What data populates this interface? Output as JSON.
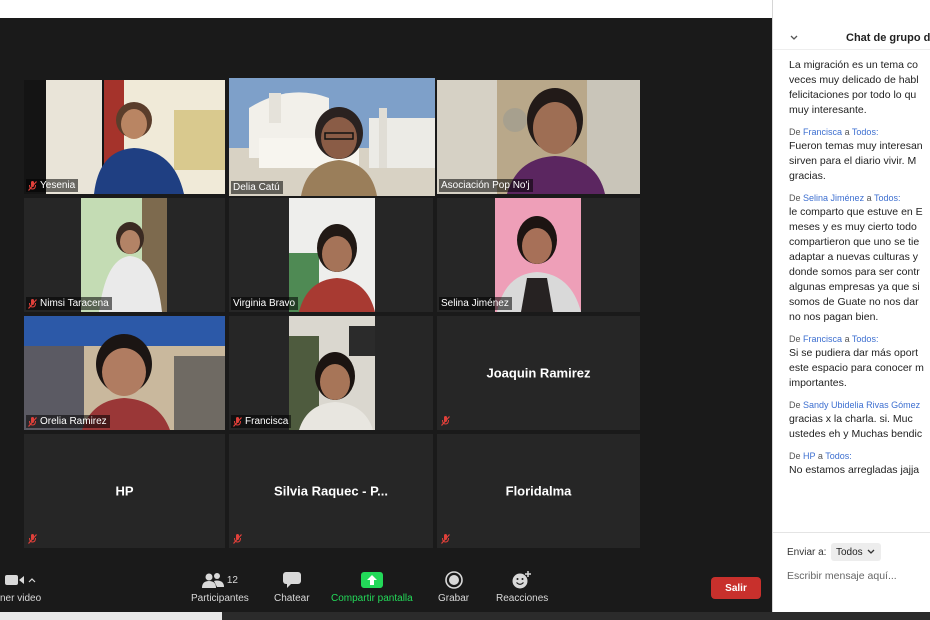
{
  "participants": [
    {
      "name": "Yesenia",
      "muted": true
    },
    {
      "name": "Delia Catú",
      "muted": false,
      "speaking": true
    },
    {
      "name": "Asociación Pop No'j",
      "muted": false
    },
    {
      "name": "Nimsi Taracena",
      "muted": true
    },
    {
      "name": "Virginia Bravo",
      "muted": false
    },
    {
      "name": "Selina Jiménez",
      "muted": false
    },
    {
      "name": "Orelia Ramirez",
      "muted": true
    },
    {
      "name": "Francisca",
      "muted": true
    },
    {
      "name": "Joaquin Ramirez",
      "muted": true
    },
    {
      "name": "HP",
      "muted": true
    },
    {
      "name": "Silvia Raquec - P...",
      "muted": true
    },
    {
      "name": "Floridalma",
      "muted": true
    }
  ],
  "toolbar": {
    "video_label": "ner video",
    "participants_label": "Participantes",
    "participants_count": "12",
    "chat_label": "Chatear",
    "share_label": "Compartir pantalla",
    "record_label": "Grabar",
    "reactions_label": "Reacciones",
    "leave_label": "Salir"
  },
  "chat": {
    "title": "Chat de grupo d",
    "messages": [
      {
        "from": "",
        "to": "",
        "text": "La migración es un tema co\nveces muy delicado de habl\nfelicitaciones por todo lo qu\nmuy interesante."
      },
      {
        "from": "Francisca",
        "to": "Todos:",
        "text": "Fueron temas muy interesan\nsirven para el diario vivir. M\ngracias."
      },
      {
        "from": "Selina Jiménez",
        "to": "Todos:",
        "text": "le comparto que estuve en E\nmeses y es muy cierto todo\ncompartieron que uno se tie\nadaptar a nuevas culturas y\ndonde somos para ser contr\nalgunas empresas ya que si\nsomos de Guate no nos dar\nno nos pagan bien."
      },
      {
        "from": "Francisca",
        "to": "Todos:",
        "text": "Si se pudiera dar más oport\neste espacio para conocer m\nimportantes."
      },
      {
        "from": "Sandy Ubidelia Rivas Gómez",
        "to": "",
        "text": "gracias x la charla.   si.  Muc\nustedes eh y Muchas bendic"
      },
      {
        "from": "HP",
        "to": "Todos:",
        "text": "No estamos arregladas jajja"
      }
    ],
    "meta_prefix": "De",
    "meta_joiner": "a",
    "send_to_label": "Enviar a:",
    "send_to_value": "Todos",
    "input_placeholder": "Escribir mensaje aquí..."
  },
  "colors": {
    "speaker_border": "#c6e35a",
    "leave_button": "#c8302c",
    "share_green": "#23d959",
    "chat_link": "#3d6fd0"
  }
}
